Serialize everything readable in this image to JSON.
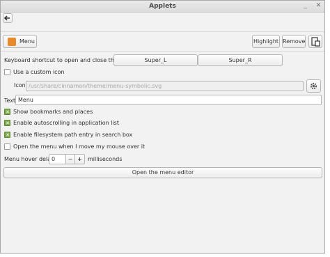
{
  "window": {
    "title": "Applets"
  },
  "toolbar": {
    "applet_label": "Menu",
    "highlight_label": "Highlight",
    "remove_label": "Remove"
  },
  "settings": {
    "shortcut_label": "Keyboard shortcut to open and close the menu",
    "shortcut_primary": "Super_L",
    "shortcut_secondary": "Super_R",
    "custom_icon_label": "Use a custom icon",
    "icon_label": "Icon",
    "icon_path": "/usr/share/cinnamon/theme/menu-symbolic.svg",
    "text_label": "Text",
    "text_value": "Menu",
    "bookmarks_label": "Show bookmarks and places",
    "autoscroll_label": "Enable autoscrolling in application list",
    "filesystem_label": "Enable filesystem path entry in search box",
    "hover_open_label": "Open the menu when I move my mouse over it",
    "hover_delay_label": "Menu hover delay:",
    "hover_delay_value": "0",
    "hover_delay_unit": "milliseconds",
    "decrement_label": "−",
    "increment_label": "+",
    "editor_button_label": "Open the menu editor"
  },
  "checks": {
    "custom_icon": false,
    "bookmarks": true,
    "autoscroll": true,
    "filesystem": true,
    "hover_open": false
  },
  "colors": {
    "check_on": "#7da84e",
    "applet_icon": "#e88a2c"
  }
}
